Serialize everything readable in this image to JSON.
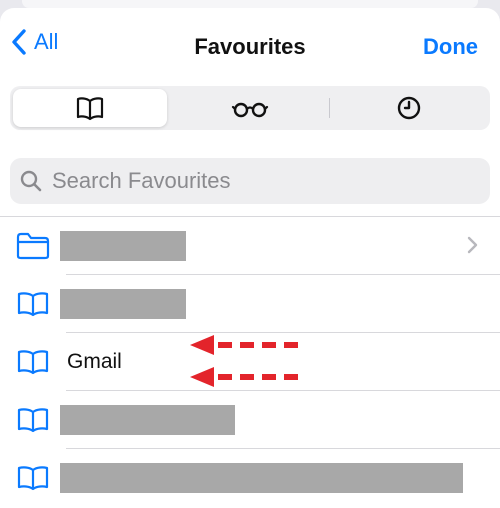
{
  "nav": {
    "back_label": "All",
    "title": "Favourites",
    "done_label": "Done"
  },
  "segments": [
    {
      "icon": "book-icon",
      "selected": true
    },
    {
      "icon": "reading-glasses-icon",
      "selected": false
    },
    {
      "icon": "clock-icon",
      "selected": false
    }
  ],
  "search": {
    "placeholder": "Search Favourites"
  },
  "items": [
    {
      "icon": "folder-icon",
      "label": "",
      "redacted": true,
      "has_chevron": true
    },
    {
      "icon": "book-icon",
      "label": "",
      "redacted": true
    },
    {
      "icon": "book-icon",
      "label": "Gmail",
      "redacted": false
    },
    {
      "icon": "book-icon",
      "label": "",
      "redacted": true
    },
    {
      "icon": "book-icon",
      "label": "",
      "redacted": true
    }
  ],
  "annotations": {
    "arrow_color": "#e3242b",
    "count": 2
  },
  "colors": {
    "accent": "#0a7aff",
    "redaction": "#a8a8a8"
  }
}
